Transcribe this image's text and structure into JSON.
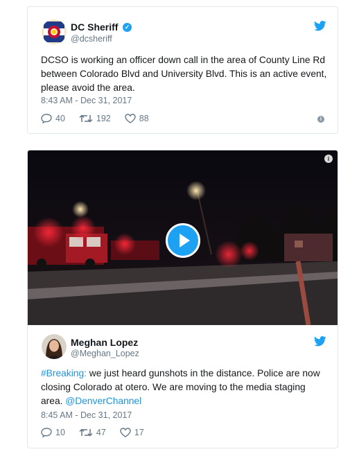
{
  "tweets": [
    {
      "display_name": "DC Sheriff",
      "handle": "@dcsheriff",
      "text": "DCSO is working an officer down call in the area of County Line Rd between Colorado Blvd and University Blvd. This is an active event, please avoid the area.",
      "timestamp": "8:43 AM - Dec 31, 2017",
      "replies": "40",
      "retweets": "192",
      "likes": "88"
    },
    {
      "display_name": "Meghan Lopez",
      "handle": "@Meghan_Lopez",
      "text_hashtag": "#Breaking:",
      "text_body": " we just heard gunshots in the distance. Police are now closing Colorado at otero. We are moving to the media staging area. ",
      "text_mention": "@DenverChannel",
      "timestamp": "8:45 AM - Dec 31, 2017",
      "replies": "10",
      "retweets": "47",
      "likes": "17"
    }
  ],
  "colors": {
    "twitter_blue": "#1da1f2",
    "link": "#1b95e0",
    "secondary_text": "#657786",
    "border": "#e1e8ed"
  },
  "icons": {
    "twitter_bird": "twitter-bird-icon",
    "verified": "verified-badge-icon",
    "reply": "reply-icon",
    "retweet": "retweet-icon",
    "like": "heart-icon",
    "info": "info-icon",
    "play": "play-icon"
  }
}
